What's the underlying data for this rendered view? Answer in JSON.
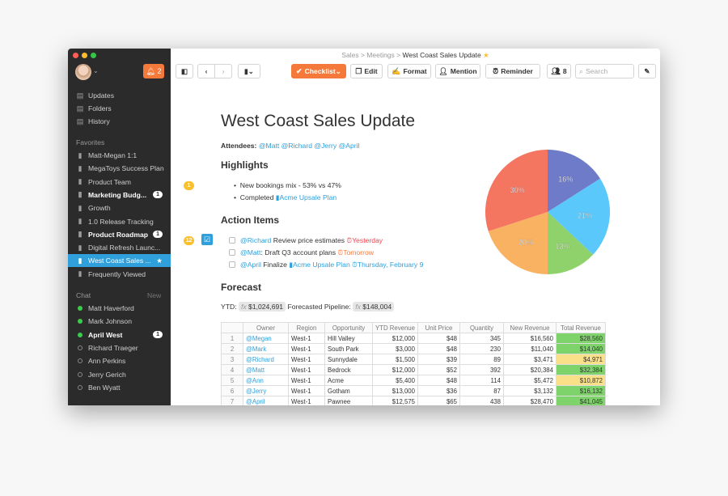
{
  "window_controls": {
    "colors": [
      "#fc5f57",
      "#fdbc2e",
      "#33c748"
    ]
  },
  "sidebar": {
    "notifications_count": "2",
    "nav": [
      {
        "label": "Updates",
        "icon": "updates-icon"
      },
      {
        "label": "Folders",
        "icon": "folders-icon"
      },
      {
        "label": "History",
        "icon": "history-icon"
      }
    ],
    "favorites_label": "Favorites",
    "favorites": [
      {
        "label": "Matt-Megan 1:1"
      },
      {
        "label": "MegaToys Success Plan"
      },
      {
        "label": "Product Team",
        "icon": "chat-icon"
      },
      {
        "label": "Marketing Budg...",
        "bold": true,
        "badge": "1",
        "icon": "spreadsheet-icon"
      },
      {
        "label": "Growth",
        "icon": "folder-icon"
      },
      {
        "label": "1.0 Release Tracking"
      },
      {
        "label": "Product Roadmap",
        "bold": true,
        "badge": "1"
      },
      {
        "label": "Digital Refresh Launc..."
      },
      {
        "label": "West Coast Sales ...",
        "selected": true,
        "starred": true
      },
      {
        "label": "Frequently Viewed",
        "icon": "docs-icon"
      }
    ],
    "chat_label": "Chat",
    "chat_new": "New",
    "chat": [
      {
        "label": "Matt Haverford",
        "online": true
      },
      {
        "label": "Mark Johnson",
        "online": true
      },
      {
        "label": "April West",
        "online": true,
        "bold": true,
        "badge": "1"
      },
      {
        "label": "Richard Traeger",
        "online": false
      },
      {
        "label": "Ann Perkins",
        "online": false
      },
      {
        "label": "Jerry Gerich",
        "online": false
      },
      {
        "label": "Ben Wyatt",
        "online": false
      }
    ]
  },
  "breadcrumb": {
    "items": [
      "Sales",
      "Meetings"
    ],
    "current": "West Coast Sales Update",
    "sep": ">"
  },
  "toolbar": {
    "checklist": "Checklist",
    "edit": "Edit",
    "format": "Format",
    "mention": "Mention",
    "reminder": "Reminder",
    "members": "8",
    "search_placeholder": "Search",
    "accent": "#f5793a"
  },
  "doc": {
    "title": "West Coast Sales Update",
    "attendees_label": "Attendees:",
    "attendees": "@Matt @Richard @Jerry @April",
    "highlights_title": "Highlights",
    "highlights": [
      "New bookings mix - 53% vs 47%",
      "Completed"
    ],
    "highlight_link": "Acme Upsale Plan",
    "comment_count_1": "1",
    "comment_count_2": "12",
    "action_title": "Action Items",
    "actions": [
      {
        "mention": "@Richard",
        "text": " Review price estimates ",
        "due": "Yesterday"
      },
      {
        "mention": "@Matt",
        "text": ": Draft Q3 account plans ",
        "due": "Tomorrow"
      },
      {
        "mention": "@April",
        "text": " Finalize ",
        "link": "Acme Upsale Plan",
        "due": "Thursday, February 9"
      }
    ],
    "forecast_title": "Forecast",
    "ytd_label": "YTD:",
    "ytd": "$1,024,691",
    "pipeline_label": "Forecasted Pipeline:",
    "pipeline": "$148,004",
    "fx": "fx"
  },
  "table": {
    "headers": [
      "",
      "Owner",
      "Region",
      "Opportunity",
      "YTD Revenue",
      "Unit Price",
      "Quantity",
      "New Revenue",
      "Total Revenue"
    ],
    "rows": [
      [
        "1",
        "@Megan",
        "West-1",
        "Hill Valley",
        "$12,000",
        "$48",
        "345",
        "$16,560",
        "$28,560"
      ],
      [
        "2",
        "@Mark",
        "West-1",
        "South Park",
        "$3,000",
        "$48",
        "230",
        "$11,040",
        "$14,040"
      ],
      [
        "3",
        "@Richard",
        "West-1",
        "Sunnydale",
        "$1,500",
        "$39",
        "89",
        "$3,471",
        "$4,971"
      ],
      [
        "4",
        "@Matt",
        "West-1",
        "Bedrock",
        "$12,000",
        "$52",
        "392",
        "$20,384",
        "$32,384"
      ],
      [
        "5",
        "@Ann",
        "West-1",
        "Acme",
        "$5,400",
        "$48",
        "114",
        "$5,472",
        "$10,872"
      ],
      [
        "6",
        "@Jerry",
        "West-1",
        "Gotham",
        "$13,000",
        "$36",
        "87",
        "$3,132",
        "$16,132"
      ],
      [
        "7",
        "@April",
        "West-1",
        "Pawnee",
        "$12,575",
        "$65",
        "438",
        "$28,470",
        "$41,045"
      ]
    ],
    "total_colors": [
      "#7ed36a",
      "#7ed36a",
      "#fbe08a",
      "#7ed36a",
      "#fbe08a",
      "#7ed36a",
      "#7ed36a"
    ]
  },
  "chart_data": {
    "type": "pie",
    "values": [
      16,
      21,
      13,
      20,
      30
    ],
    "labels": [
      "16%",
      "21%",
      "13%",
      "20%",
      "30%"
    ],
    "colors": [
      "#6e7bc9",
      "#5ac8fa",
      "#8fd16a",
      "#f9b262",
      "#f47560"
    ]
  }
}
